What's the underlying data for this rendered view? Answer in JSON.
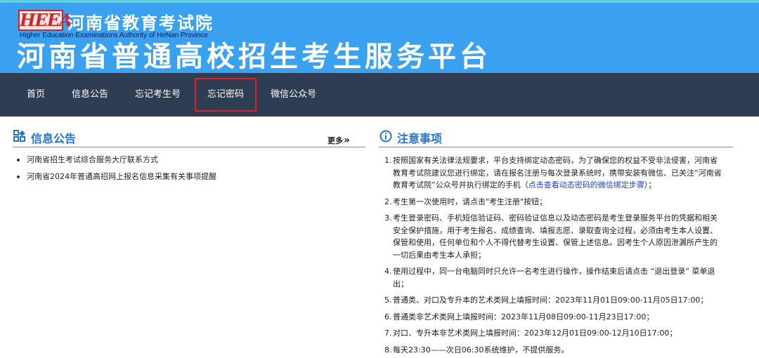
{
  "header": {
    "logo_text": "HEEA",
    "org_name": "河南省教育考试院",
    "org_name_en": "Higher Education Examinations Authority of HeNan Province",
    "platform_title": "河南省普通高校招生考生服务平台"
  },
  "nav": {
    "items": [
      {
        "label": "首页"
      },
      {
        "label": "信息公告"
      },
      {
        "label": "忘记考生号"
      },
      {
        "label": "忘记密码"
      },
      {
        "label": "微信公众号"
      }
    ],
    "highlighted": "忘记密码"
  },
  "announcements": {
    "title": "信息公告",
    "more_label": "更多",
    "more_arrows": "»",
    "items": [
      {
        "text": "河南省招生考试综合服务大厅联系方式"
      },
      {
        "text": "河南省2024年普通高招网上报名信息采集有关事项提醒"
      }
    ]
  },
  "notes": {
    "title": "注意事项",
    "items": [
      {
        "num": "1.",
        "text": "按照国家有关法律法规要求，平台支持绑定动态密码，为了确保您的权益不受非法侵害，河南省教育考试院建议您进行绑定，请在报名注册与每次登录系统时，携带安装有微信、已关注“河南省教育考试院”公众号并执行绑定的手机（",
        "link": "点击查看动态密码的微信绑定步骤",
        "suffix": "）；"
      },
      {
        "num": "2.",
        "text": "考生第一次使用时，请点击\"考生注册\"按钮；"
      },
      {
        "num": "3.",
        "text": "考生登录密码、手机短信验证码、密码验证信息以及动态密码是考生登录服务平台的凭据和相关安全保护措施，用于考生报名、成绩查询、填报志愿、录取查询全过程，必须由考生本人设置、保管和使用，任何单位和个人不得代替考生设置、保管上述信息。因考生个人原因泄漏所产生的一切后果由考生本人承担；"
      },
      {
        "num": "4.",
        "text": "使用过程中，同一台电脑同时只允许一名考生进行操作，操作结束后请点击 “退出登录” 菜单退出；"
      },
      {
        "num": "5.",
        "text": "普通类、对口及专升本的艺术类网上填报时间：2023年11月01日09:00-11月05日17:00；"
      },
      {
        "num": "6.",
        "text": "普通类非艺术类网上填报时间：2023年11月08日09:00-11月23日17:00；"
      },
      {
        "num": "7.",
        "text": "对口、专升本非艺术类网上填报时间：2023年12月01日09:00-12月10日17:00；"
      },
      {
        "num": "8.",
        "text": "每天23:30——次日06:30系统维护，不提供服务。"
      }
    ]
  },
  "colors": {
    "header_bg": "#3aa0f0",
    "nav_bg": "#2f3d52",
    "title_blue": "#1e74d6",
    "highlight_red": "#e81c22",
    "link_blue": "#2142d6"
  }
}
